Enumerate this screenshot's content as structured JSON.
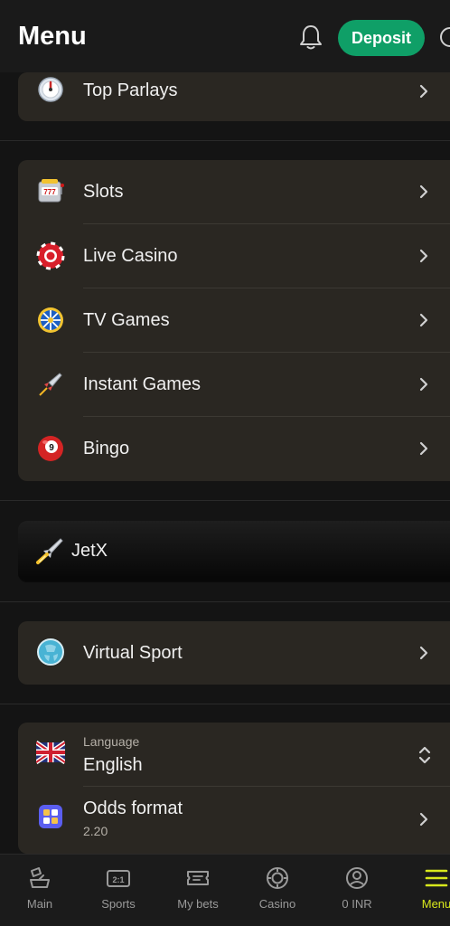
{
  "header": {
    "title": "Menu",
    "deposit_label": "Deposit"
  },
  "top_card": {
    "label": "Top Parlays"
  },
  "casino_card": {
    "items": [
      {
        "label": "Slots",
        "icon": "slot-machine-icon"
      },
      {
        "label": "Live Casino",
        "icon": "casino-chip-icon"
      },
      {
        "label": "TV Games",
        "icon": "wheel-icon"
      },
      {
        "label": "Instant Games",
        "icon": "rocket-icon"
      },
      {
        "label": "Bingo",
        "icon": "bingo-ball-icon"
      }
    ]
  },
  "jetx": {
    "label": "JetX"
  },
  "virtual_card": {
    "label": "Virtual Sport"
  },
  "settings_card": {
    "language_label": "Language",
    "language_value": "English",
    "odds_label": "Odds format",
    "odds_value": "2.20"
  },
  "bottom_nav": {
    "items": [
      {
        "label": "Main"
      },
      {
        "label": "Sports"
      },
      {
        "label": "My bets"
      },
      {
        "label": "Casino"
      },
      {
        "label": "0 INR"
      },
      {
        "label": "Menu"
      }
    ],
    "active": "Menu"
  },
  "colors": {
    "accent_green": "#0f9f67",
    "active_yellow": "#d8e81c",
    "card_bg": "#2a2722"
  }
}
